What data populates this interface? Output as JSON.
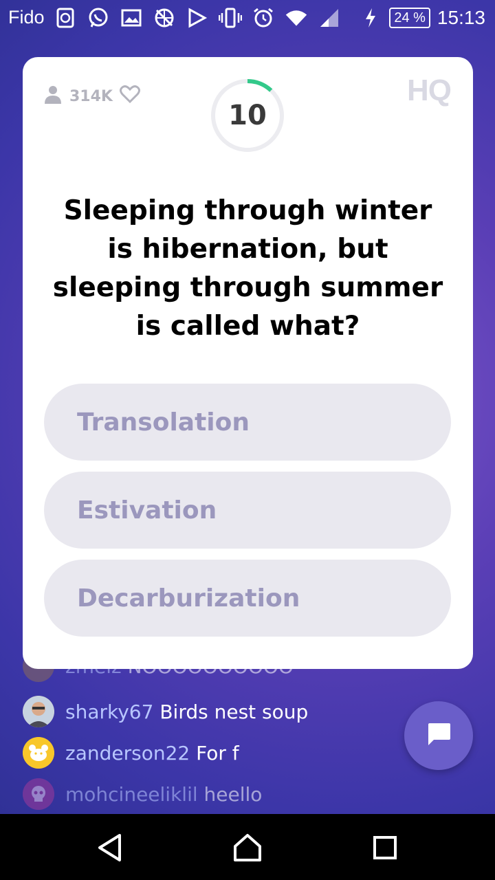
{
  "status_bar": {
    "carrier": "Fido",
    "icons": [
      "refresh-badge-icon",
      "whatsapp-icon",
      "image-icon",
      "globe-crossed-icon",
      "play-store-icon",
      "vibrate-icon",
      "alarm-icon",
      "wifi-icon",
      "signal-icon",
      "charging-icon"
    ],
    "battery": "24 %",
    "time": "15:13"
  },
  "card": {
    "player_count": "314K",
    "logo": "HQ",
    "timer": "10",
    "timer_progress": 0.12,
    "question": "Sleeping through winter is hibernation, but sleeping through summer is called what?",
    "answers": [
      "Transolation",
      "Estivation",
      "Decarburization"
    ]
  },
  "chat": {
    "messages": [
      {
        "user": "zmelz",
        "text": "NOOOOOOOOOO"
      },
      {
        "user": "sharky67",
        "text": "Birds nest soup"
      },
      {
        "user": "zanderson22",
        "text": "For f"
      },
      {
        "user": "mohcineeliklil",
        "text": "heello"
      }
    ]
  },
  "colors": {
    "accent_green": "#33c98a",
    "answer_bg": "#e9e8ef",
    "answer_text": "#9b97bd",
    "background_purple": "#4b3cae",
    "username_blue": "#b8c6ff"
  }
}
